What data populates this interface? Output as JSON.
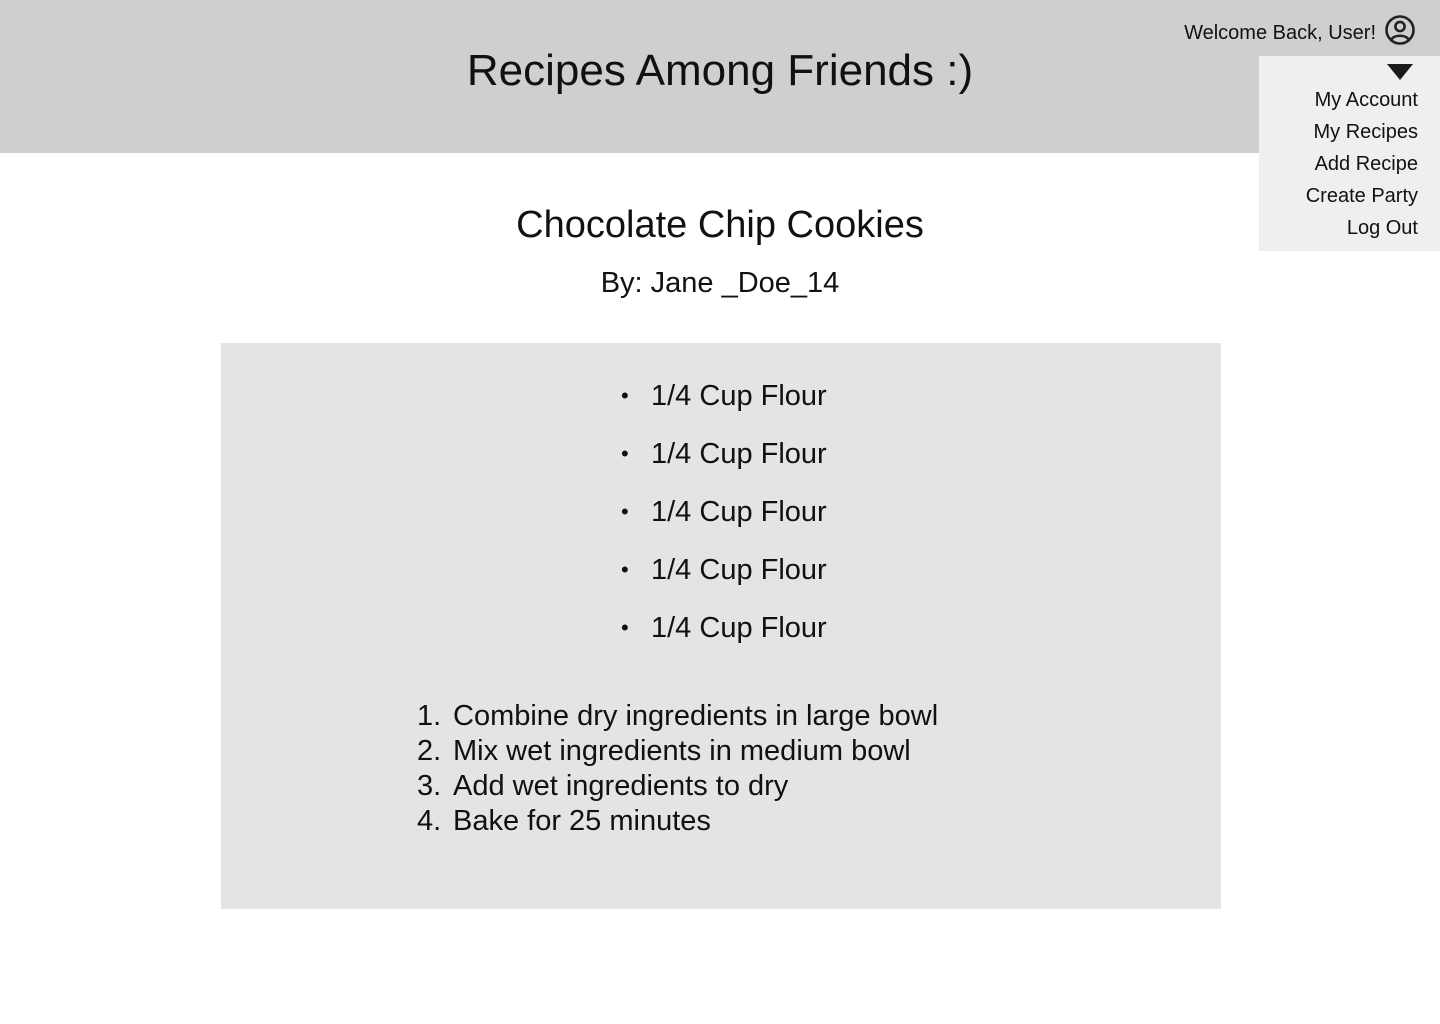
{
  "header": {
    "site_title": "Recipes Among Friends :)",
    "welcome_text": "Welcome Back, User!",
    "avatar_icon": "user-circle-icon",
    "caret_icon": "caret-down-icon"
  },
  "user_menu": {
    "items": [
      {
        "label": "My Account"
      },
      {
        "label": "My Recipes"
      },
      {
        "label": "Add Recipe"
      },
      {
        "label": "Create Party"
      },
      {
        "label": "Log Out"
      }
    ]
  },
  "recipe": {
    "title": "Chocolate Chip Cookies",
    "author": "By: Jane _Doe_14",
    "ingredients": [
      {
        "bullet": "•",
        "text": "1/4 Cup Flour"
      },
      {
        "bullet": "•",
        "text": "1/4 Cup Flour"
      },
      {
        "bullet": "•",
        "text": "1/4 Cup Flour"
      },
      {
        "bullet": "•",
        "text": "1/4 Cup Flour"
      },
      {
        "bullet": "•",
        "text": "1/4 Cup Flour"
      }
    ],
    "steps": [
      {
        "number": "1.",
        "text": "Combine dry ingredients in large bowl"
      },
      {
        "number": "2.",
        "text": "Mix wet ingredients in medium bowl"
      },
      {
        "number": "3.",
        "text": "Add wet ingredients to dry"
      },
      {
        "number": "4.",
        "text": "Bake for 25 minutes"
      }
    ]
  },
  "colors": {
    "header_bg": "#cfcfcf",
    "menu_bg": "#efefef",
    "card_bg": "#e4e4e4",
    "text": "#111111"
  }
}
